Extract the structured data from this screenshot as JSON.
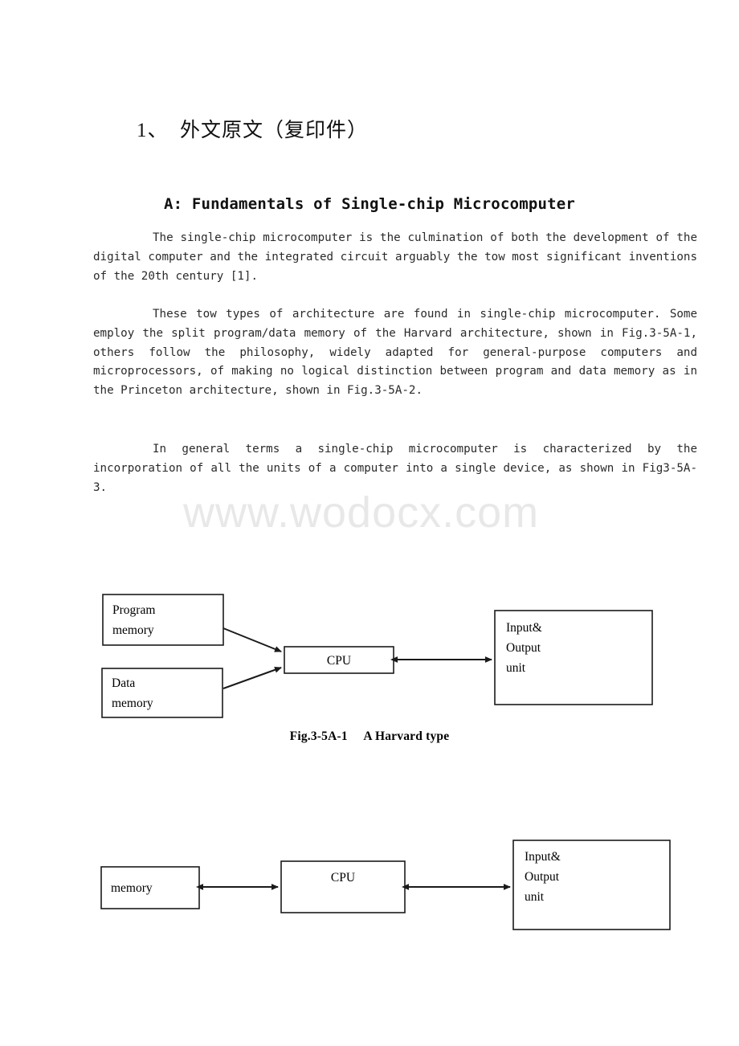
{
  "document": {
    "section_title": "1、  外文原文（复印件）",
    "article_heading": "A: Fundamentals of Single-chip Microcomputer",
    "paragraphs": {
      "p1": "The single-chip microcomputer is the culmination of both the development of the digital computer and the integrated circuit arguably the tow most significant inventions of the 20th century [1].",
      "p2": "These tow types of architecture are found in single-chip microcomputer. Some employ the split program/data memory of the Harvard architecture, shown in Fig.3-5A-1, others follow the philosophy, widely adapted for general-purpose computers and microprocessors, of making no logical distinction between program and data memory as in the Princeton architecture, shown in Fig.3-5A-2.",
      "p3": "In general terms a single-chip microcomputer is characterized by the incorporation of all the units of a computer into a single device, as shown in Fig3-5A-3."
    },
    "watermark": "www.wodocx.com"
  },
  "figures": {
    "harvard": {
      "caption": "Fig.3-5A-1     A Harvard type",
      "boxes": {
        "program_memory_line1": "Program",
        "program_memory_line2": "memory",
        "data_memory_line1": "Data",
        "data_memory_line2": "memory",
        "cpu": "CPU",
        "io_line1": "Input&",
        "io_line2": "Output",
        "io_line3": "unit"
      }
    },
    "princeton": {
      "boxes": {
        "memory": "memory",
        "cpu": "CPU",
        "io_line1": "Input&",
        "io_line2": "Output",
        "io_line3": "unit"
      }
    }
  },
  "colors": {
    "text": "#000000",
    "body_text": "#2a2a2a",
    "watermark": "#e8e8e8",
    "stroke": "#1a1a1a",
    "background": "#ffffff"
  }
}
